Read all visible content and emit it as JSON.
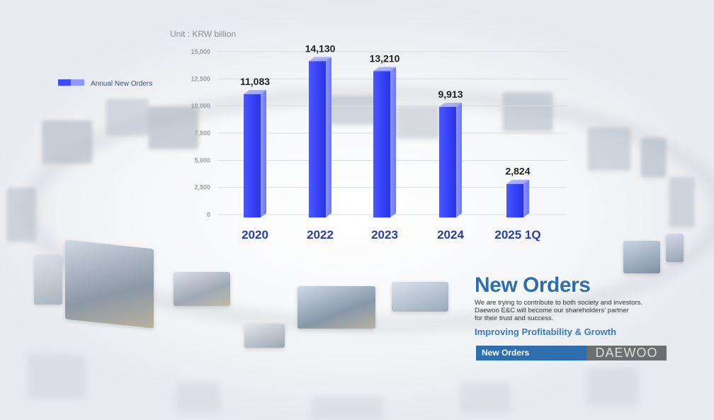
{
  "chart_data": {
    "type": "bar",
    "title": "",
    "unit_label": "Unit : KRW billion",
    "categories": [
      "2020",
      "2022",
      "2023",
      "2024",
      "2025 1Q"
    ],
    "series": [
      {
        "name": "Annual New Orders",
        "values": [
          11083,
          14130,
          13210,
          9913,
          2824
        ]
      }
    ],
    "value_labels": [
      "11,083",
      "14,130",
      "13,210",
      "9,913",
      "2,824"
    ],
    "yticks": [
      "0",
      "2,500",
      "5,000",
      "7,500",
      "10,000",
      "12,500",
      "15,000"
    ],
    "ylim": [
      0,
      15000
    ],
    "grid": true,
    "legend_position": "left",
    "bar_color": "#3f4cff"
  },
  "hero": {
    "title": "New Orders",
    "description_lines": [
      "We are trying to contribute to both society and investors.",
      "Daewoo E&C will become our shareholders' partner",
      "for their trust and success."
    ],
    "subtitle": "Improving Profitability & Growth"
  },
  "bottom_bar": {
    "section_label": "New Orders",
    "brand": "DAEWOO"
  },
  "colors": {
    "accent": "#2d6eaf",
    "bar": "#3f4cff",
    "brand_bg": "#6d6e70"
  }
}
